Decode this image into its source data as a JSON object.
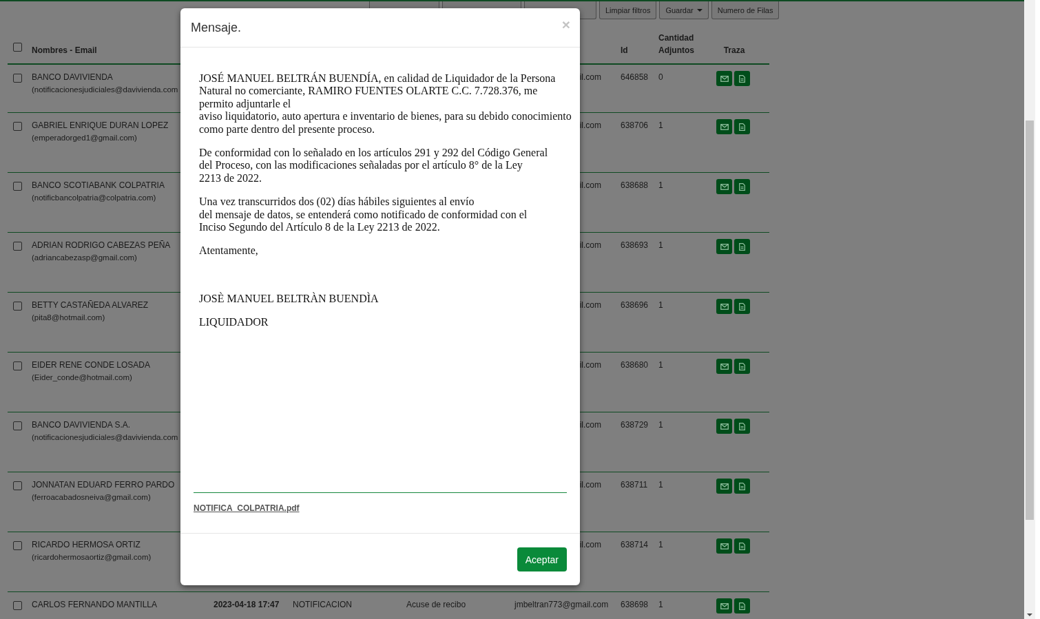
{
  "toolbar": {
    "buttons": [
      {
        "kind": "plain"
      },
      {
        "kind": "plain"
      },
      {
        "kind": "plain"
      },
      {
        "label": "Limpiar filtros",
        "kind": "plain"
      },
      {
        "label": "Guardar",
        "kind": "dropdown"
      },
      {
        "label": "Numero de Filas",
        "kind": "plain"
      }
    ]
  },
  "table": {
    "select_all": {
      "checked": false
    },
    "headers": {
      "name": "Nombres - Email",
      "id": "Id",
      "attachments": "Cantidad Adjuntos",
      "trace": "Traza"
    },
    "rows": [
      {
        "checked": false,
        "name": "BANCO DAVIVIENDA",
        "email": "(notificacionesjudiciales@davivienda.com",
        "recipient": "il.com",
        "id": "646858",
        "attachments": "0"
      },
      {
        "checked": false,
        "name": "GABRIEL ENRIQUE DURAN LOPEZ",
        "email": "(emperadorged1@gmail.com)",
        "recipient": "il.com",
        "id": "638706",
        "attachments": "1"
      },
      {
        "checked": false,
        "name": "BANCO SCOTIABANK COLPATRIA",
        "email": "(notificbancolpatria@colpatria.com)",
        "recipient": "il.com",
        "id": "638688",
        "attachments": "1"
      },
      {
        "checked": false,
        "name": "ADRIAN RODRIGO CABEZAS PEÑA",
        "email": "(adriancabezasp@gmail.com)",
        "recipient": "il.com",
        "id": "638693",
        "attachments": "1"
      },
      {
        "checked": false,
        "name": "BETTY CASTAÑEDA ALVAREZ",
        "email": "(pita8@hotmail.com)",
        "recipient": "il.com",
        "id": "638696",
        "attachments": "1"
      },
      {
        "checked": false,
        "name": "EIDER RENE CONDE LOSADA",
        "email": "(Eider_conde@hotmail.com)",
        "recipient": "il.com",
        "id": "638680",
        "attachments": "1"
      },
      {
        "checked": false,
        "name": "BANCO DAVIVIENDA S.A.",
        "email": "(notificacionesjudiciales@davivienda.com",
        "recipient": "il.com",
        "id": "638729",
        "attachments": "1"
      },
      {
        "checked": false,
        "name": "JONNATAN EDUARD FERRO PARDO",
        "email": "(ferroacabadosneiva@gmail.com)",
        "recipient": "il.com",
        "id": "638711",
        "attachments": "1"
      },
      {
        "checked": false,
        "name": "RICARDO HERMOSA ORTIZ",
        "email": "(ricardohermosaortiz@gmail.com)",
        "recipient": "il.com",
        "id": "638714",
        "attachments": "1"
      },
      {
        "checked": false,
        "name": "CARLOS FERNANDO MANTILLA",
        "sent": "2023-04-18 17:47",
        "subject": "NOTIFICACION",
        "status": "Acuse de recibo",
        "recipient": "jmbeltran773@gmail.com",
        "id": "638698",
        "attachments": "1"
      }
    ]
  },
  "modal": {
    "title": "Mensaje.",
    "close": "×",
    "paragraphs": [
      "JOSÉ MANUEL BELTRÁN BUENDÍA, en calidad de Liquidador de la Persona\nNatural no comerciante, RAMIRO FUENTES OLARTE C.C. 7.728.376, me\npermito adjuntarle el\naviso liquidatorio, auto apertura e inventario de bienes, para su debido conocimiento\ncomo parte dentro del presente proceso.",
      "De conformidad con lo señalado en los artículos 291 y 292 del Código General\ndel Proceso, con las modificaciones señaladas por el artículo 8° de la Ley\n2213 de 2022.",
      "Una vez transcurridos dos (02) días hábiles siguientes al envío\ndel mensaje de datos, se entenderá como notificado de conformidad con el\nInciso Segundo del Artículo 8 de la Ley 2213 de 2022.",
      "Atentamente,",
      "JOSÈ MANUEL BELTRÀN BUENDÌA",
      "LIQUIDADOR"
    ],
    "attachment": "NOTIFICA_COLPATRIA.pdf",
    "button": "Aceptar"
  }
}
